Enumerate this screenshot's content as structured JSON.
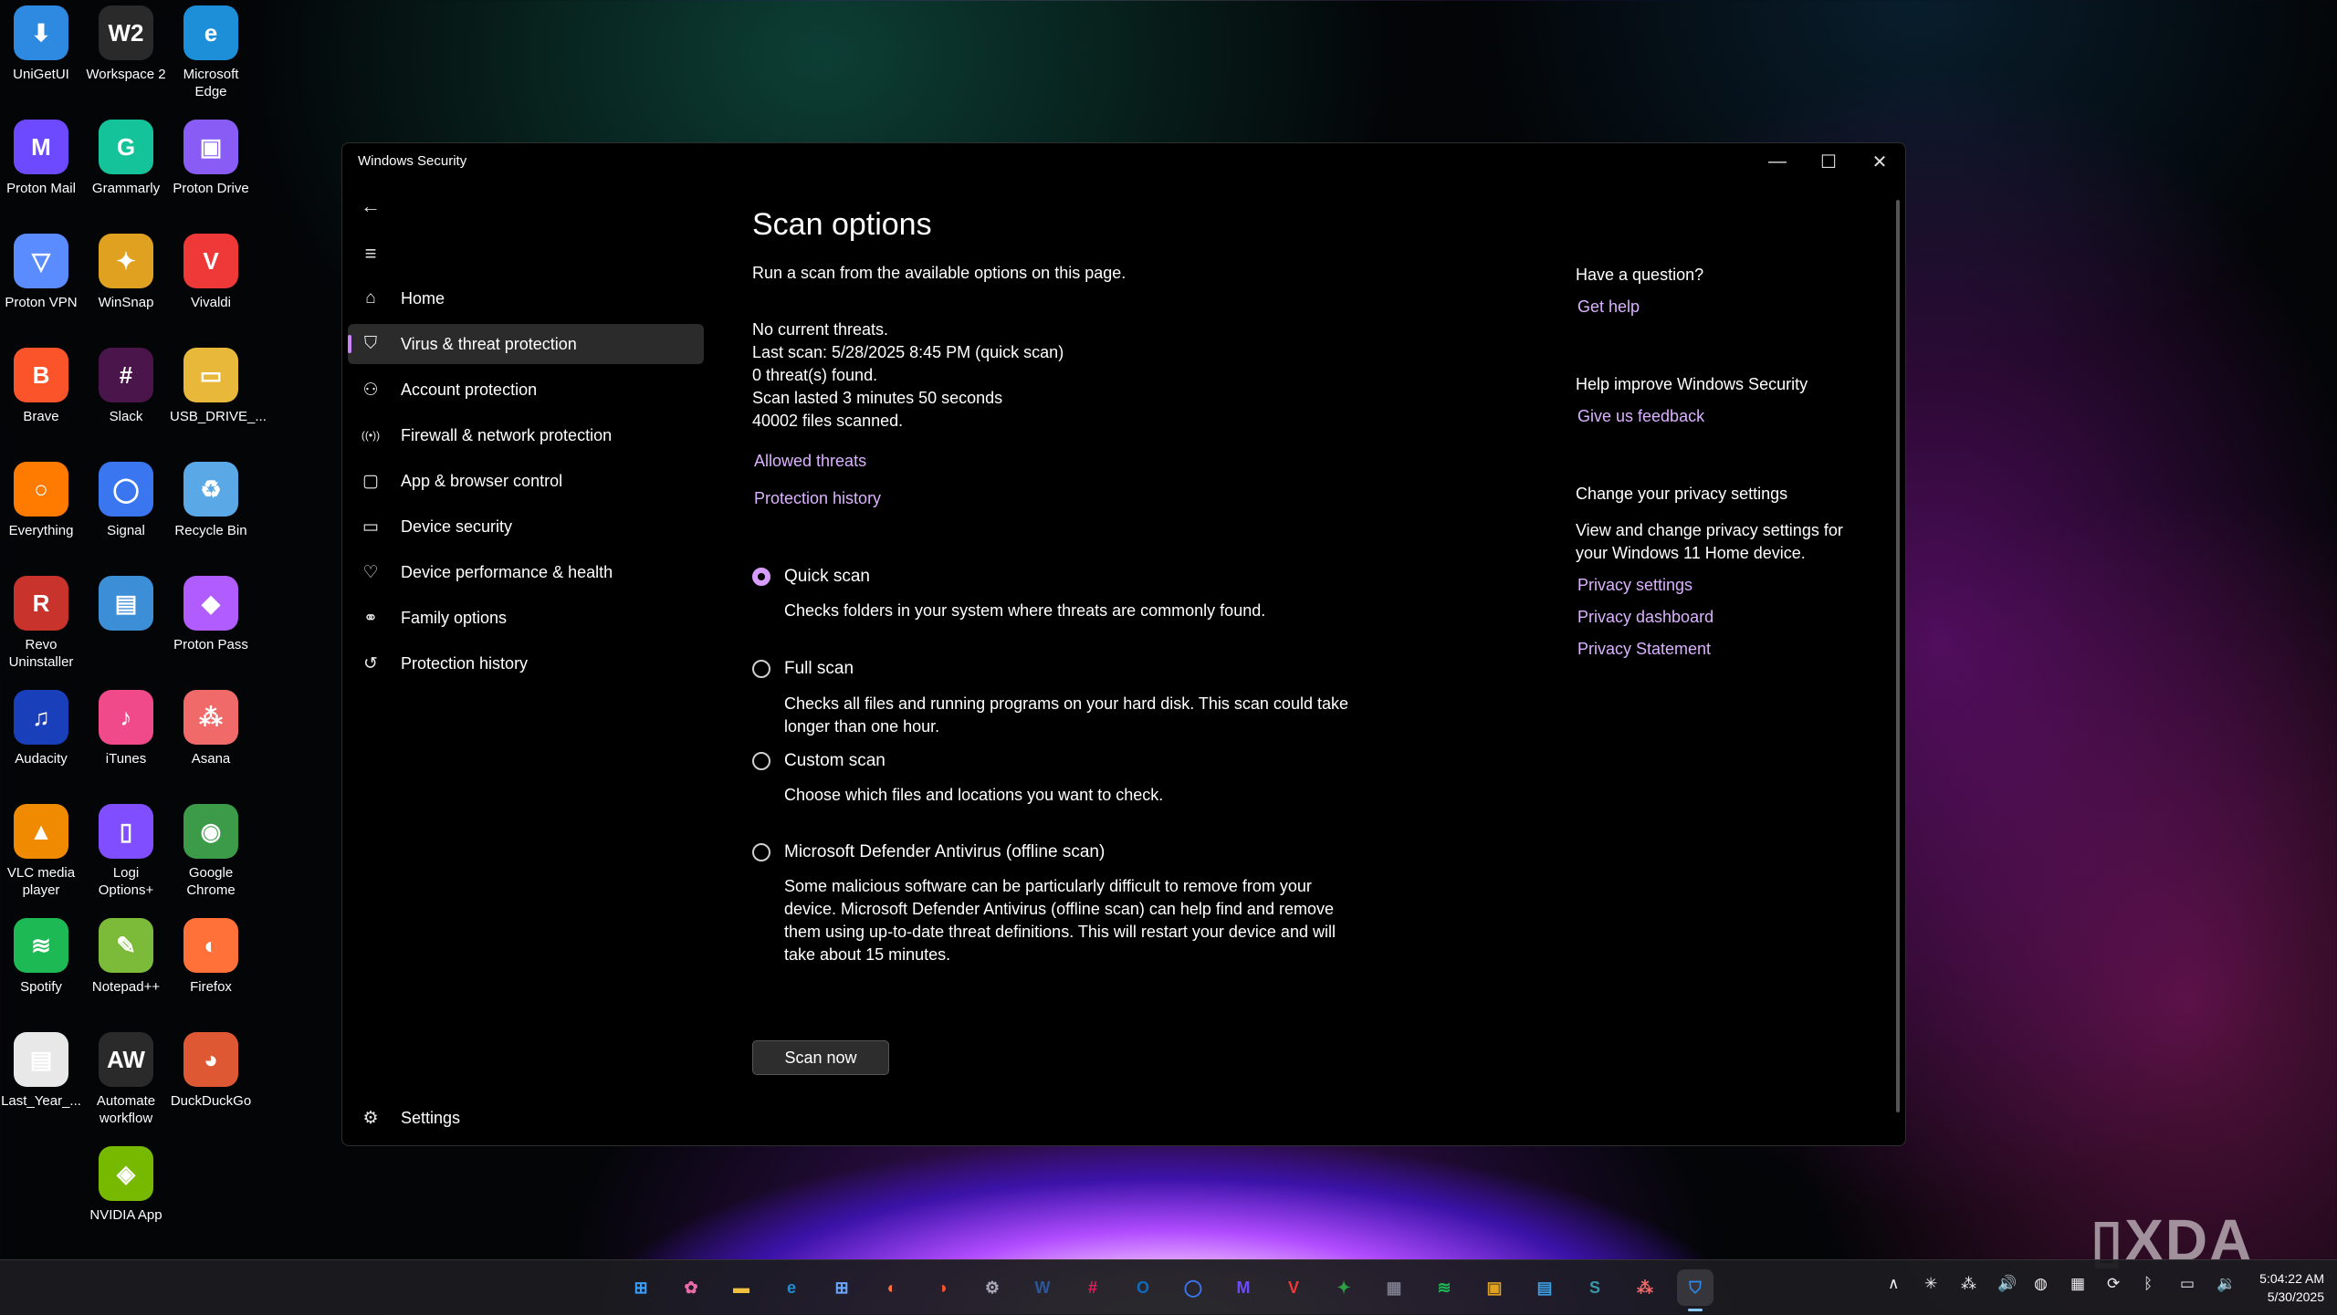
{
  "desktop_icons": [
    {
      "label": "UniGetUI",
      "glyph": "⬇",
      "color": "#2d8ae0"
    },
    {
      "label": "Workspace 2",
      "glyph": "W2",
      "color": "#2a2a2a"
    },
    {
      "label": "Microsoft Edge",
      "glyph": "e",
      "color": "#1c8fd8"
    },
    {
      "label": "Proton Mail",
      "glyph": "M",
      "color": "#6d4aff"
    },
    {
      "label": "Grammarly",
      "glyph": "G",
      "color": "#15c39a"
    },
    {
      "label": "Proton Drive",
      "glyph": "▣",
      "color": "#8a5cf6"
    },
    {
      "label": "Proton VPN",
      "glyph": "▽",
      "color": "#5b8cff"
    },
    {
      "label": "WinSnap",
      "glyph": "✦",
      "color": "#e0a020"
    },
    {
      "label": "Vivaldi",
      "glyph": "V",
      "color": "#ef3939"
    },
    {
      "label": "Brave",
      "glyph": "B",
      "color": "#fb542b"
    },
    {
      "label": "Slack",
      "glyph": "#",
      "color": "#4a154b"
    },
    {
      "label": "USB_DRIVE_...",
      "glyph": "▭",
      "color": "#e8b83a"
    },
    {
      "label": "Everything",
      "glyph": "○",
      "color": "#ff7b00"
    },
    {
      "label": "Signal",
      "glyph": "◯",
      "color": "#3a76f0"
    },
    {
      "label": "Recycle Bin",
      "glyph": "♻",
      "color": "#5aa9e6"
    },
    {
      "label": "Revo Uninstaller",
      "glyph": "R",
      "color": "#c8342b"
    },
    {
      "label": "",
      "glyph": "▤",
      "color": "#3c8fd6"
    },
    {
      "label": "Proton Pass",
      "glyph": "◆",
      "color": "#b05cff"
    },
    {
      "label": "Audacity",
      "glyph": "♫",
      "color": "#1a3fbb"
    },
    {
      "label": "iTunes",
      "glyph": "♪",
      "color": "#f04a8a"
    },
    {
      "label": "Asana",
      "glyph": "⁂",
      "color": "#f06a6a"
    },
    {
      "label": "VLC media player",
      "glyph": "▲",
      "color": "#f08a00"
    },
    {
      "label": "Logi Options+",
      "glyph": "▯",
      "color": "#814eff"
    },
    {
      "label": "Google Chrome",
      "glyph": "◉",
      "color": "#3b9b48"
    },
    {
      "label": "Spotify",
      "glyph": "≋",
      "color": "#1db954"
    },
    {
      "label": "Notepad++",
      "glyph": "✎",
      "color": "#7cbb3a"
    },
    {
      "label": "Firefox",
      "glyph": "◐",
      "color": "#ff7139"
    },
    {
      "label": "Last_Year_...",
      "glyph": "▤",
      "color": "#e8e8e8"
    },
    {
      "label": "Automate workflow",
      "glyph": "AW",
      "color": "#2a2a2a"
    },
    {
      "label": "DuckDuckGo",
      "glyph": "◕",
      "color": "#de5833"
    },
    {
      "label": "",
      "glyph": "",
      "color": "#00000000"
    },
    {
      "label": "NVIDIA App",
      "glyph": "◈",
      "color": "#76b900"
    }
  ],
  "window": {
    "title": "Windows Security",
    "controls": {
      "minimize": "—",
      "maximize": "☐",
      "close": "✕"
    }
  },
  "nav": {
    "back_glyph": "←",
    "menu_glyph": "≡",
    "items": [
      {
        "label": "Home",
        "icon": "home-icon",
        "glyph": "⌂"
      },
      {
        "label": "Virus & threat protection",
        "icon": "shield-icon",
        "glyph": "⛉"
      },
      {
        "label": "Account protection",
        "icon": "person-icon",
        "glyph": "⚇"
      },
      {
        "label": "Firewall & network protection",
        "icon": "antenna-icon",
        "glyph": "((•))"
      },
      {
        "label": "App & browser control",
        "icon": "app-window-icon",
        "glyph": "▢"
      },
      {
        "label": "Device security",
        "icon": "laptop-icon",
        "glyph": "▭"
      },
      {
        "label": "Device performance & health",
        "icon": "heart-pulse-icon",
        "glyph": "♡"
      },
      {
        "label": "Family options",
        "icon": "family-icon",
        "glyph": "⚭"
      },
      {
        "label": "Protection history",
        "icon": "history-icon",
        "glyph": "↺"
      }
    ],
    "active_index": 1,
    "settings": {
      "label": "Settings",
      "glyph": "⚙"
    }
  },
  "main": {
    "title": "Scan options",
    "subtitle": "Run a scan from the available options on this page.",
    "status_lines": [
      "No current threats.",
      "Last scan: 5/28/2025 8:45 PM (quick scan)",
      "0 threat(s) found.",
      "Scan lasted 3 minutes 50 seconds",
      "40002 files scanned."
    ],
    "links": [
      "Allowed threats",
      "Protection history"
    ],
    "options": [
      {
        "label": "Quick scan",
        "desc": "Checks folders in your system where threats are commonly found.",
        "checked": true
      },
      {
        "label": "Full scan",
        "desc": "Checks all files and running programs on your hard disk. This scan could take longer than one hour.",
        "checked": false
      },
      {
        "label": "Custom scan",
        "desc": "Choose which files and locations you want to check.",
        "checked": false
      },
      {
        "label": "Microsoft Defender Antivirus (offline scan)",
        "desc": "Some malicious software can be particularly difficult to remove from your device. Microsoft Defender Antivirus (offline scan) can help find and remove them using up-to-date threat definitions. This will restart your device and will take about 15 minutes.",
        "checked": false
      }
    ],
    "scan_button": "Scan now"
  },
  "side": {
    "question_heading": "Have a question?",
    "get_help": "Get help",
    "improve_heading": "Help improve Windows Security",
    "feedback": "Give us feedback",
    "privacy_heading": "Change your privacy settings",
    "privacy_text": "View and change privacy settings for your Windows 11 Home device.",
    "privacy_links": [
      "Privacy settings",
      "Privacy dashboard",
      "Privacy Statement"
    ]
  },
  "taskbar": {
    "apps": [
      {
        "name": "start-button",
        "glyph": "⊞",
        "color": "#3aa0ff"
      },
      {
        "name": "copilot-app",
        "glyph": "✿",
        "color": "#e86aa8"
      },
      {
        "name": "file-explorer-app",
        "glyph": "▬",
        "color": "#f0c040"
      },
      {
        "name": "edge-app",
        "glyph": "e",
        "color": "#1c8fd8"
      },
      {
        "name": "store-app",
        "glyph": "⊞",
        "color": "#6aa8ff"
      },
      {
        "name": "firefox-app",
        "glyph": "◐",
        "color": "#ff7139"
      },
      {
        "name": "brave-app",
        "glyph": "◑",
        "color": "#fb542b"
      },
      {
        "name": "settings-app",
        "glyph": "⚙",
        "color": "#aab"
      },
      {
        "name": "word-app",
        "glyph": "W",
        "color": "#2b579a"
      },
      {
        "name": "slack-app",
        "glyph": "#",
        "color": "#e01e5a"
      },
      {
        "name": "outlook-app",
        "glyph": "O",
        "color": "#0f6cbd"
      },
      {
        "name": "signal-app",
        "glyph": "◯",
        "color": "#3a76f0"
      },
      {
        "name": "proton-mail-app",
        "glyph": "M",
        "color": "#6d4aff"
      },
      {
        "name": "vivaldi-app",
        "glyph": "V",
        "color": "#ef3939"
      },
      {
        "name": "photos-app",
        "glyph": "✦",
        "color": "#2ea043"
      },
      {
        "name": "calculator-app",
        "glyph": "▦",
        "color": "#7a7a8a"
      },
      {
        "name": "spotify-app",
        "glyph": "≋",
        "color": "#1db954"
      },
      {
        "name": "winsnap-app",
        "glyph": "▣",
        "color": "#e0a020"
      },
      {
        "name": "notepad-app",
        "glyph": "▤",
        "color": "#3c9ee0"
      },
      {
        "name": "sway-app",
        "glyph": "S",
        "color": "#3a98a8"
      },
      {
        "name": "asana-app",
        "glyph": "⁂",
        "color": "#f06a6a"
      },
      {
        "name": "windows-security-app",
        "glyph": "⛉",
        "color": "#2e88e8",
        "active": true
      }
    ],
    "tray_glyphs": [
      "∧",
      "✳",
      "⁂",
      "🔊",
      "◍",
      "▦",
      "⟳",
      "ᛒ",
      "▭",
      "🔉"
    ],
    "time": "5:04:22 AM",
    "date": "5/30/2025"
  },
  "watermark": "▯XDA"
}
